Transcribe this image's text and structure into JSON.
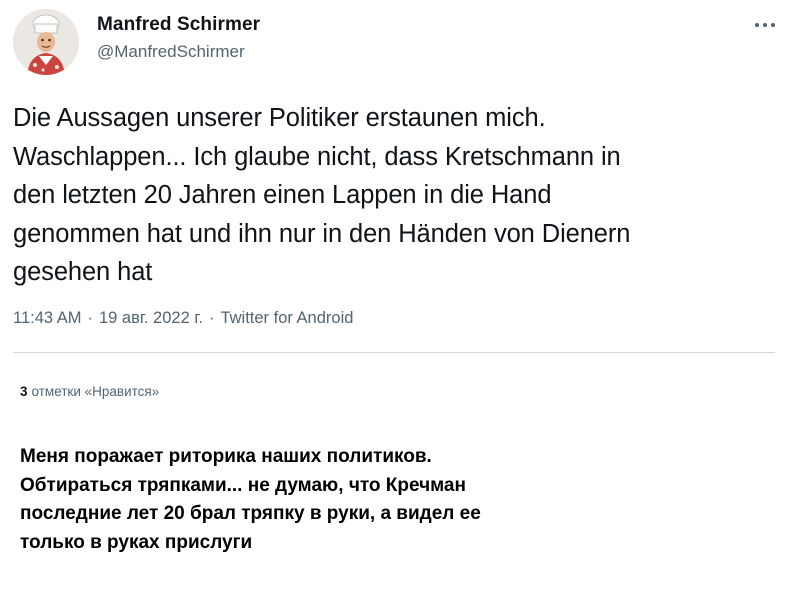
{
  "author": {
    "name": "Manfred Schirmer",
    "handle": "@ManfredSchirmer",
    "avatar_icon": "cartoon-chef-portrait-icon"
  },
  "more_icon": "ellipsis-icon",
  "tweet": {
    "text_lines": [
      "Die Aussagen unserer Politiker erstaunen mich.",
      "Waschlappen... Ich glaube nicht, dass Kretschmann in",
      "den letzten 20 Jahren einen Lappen in die Hand",
      "genommen hat und ihn nur in den Händen von Dienern",
      "gesehen hat"
    ],
    "time": "11:43 AM",
    "date": "19 авг. 2022 г.",
    "source": "Twitter for Android",
    "separator": "·"
  },
  "likes": {
    "count": "3",
    "label": "отметки «Нравится»"
  },
  "translation_lines": [
    "Меня поражает риторика наших политиков.",
    "Обтираться тряпками... не думаю, что Кречман",
    "последние лет 20 брал тряпку в руки, а видел ее",
    "только в руках прислуги"
  ],
  "colors": {
    "text_primary": "#0f1419",
    "text_secondary": "#536471",
    "divider": "#cfd9de"
  }
}
